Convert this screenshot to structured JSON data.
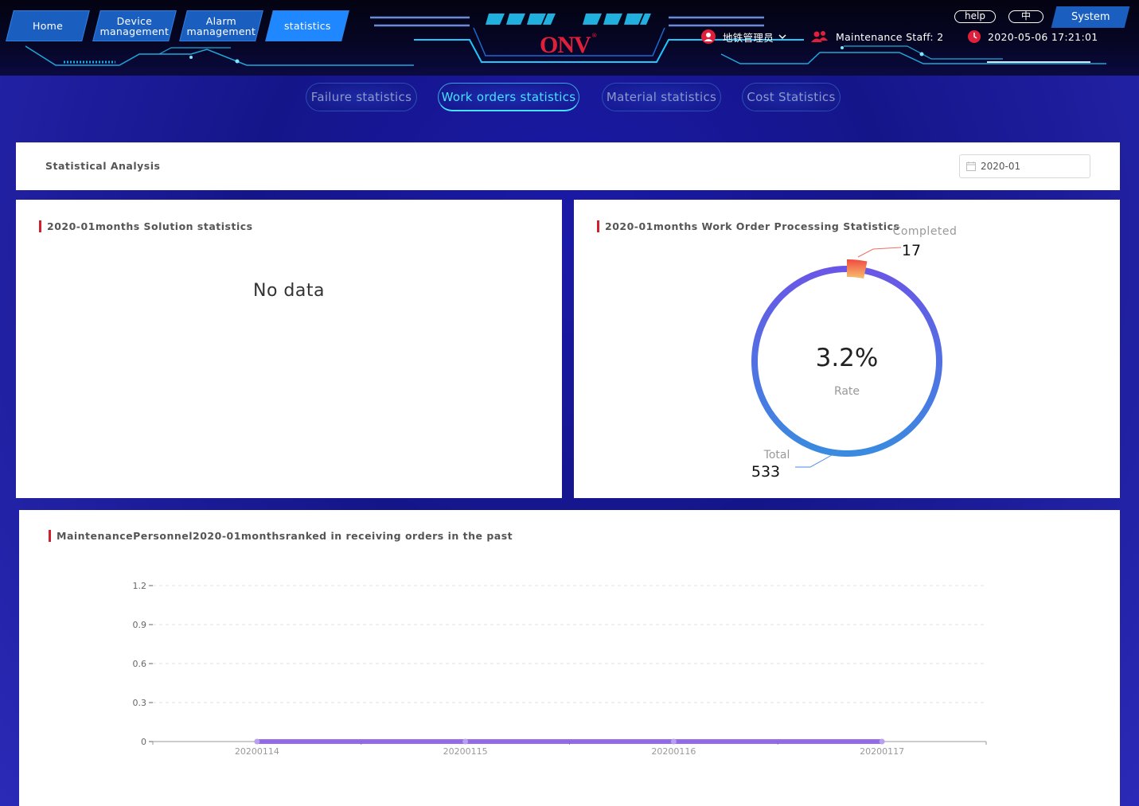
{
  "nav": {
    "tabs": [
      {
        "label": "Home"
      },
      {
        "label": "Device management"
      },
      {
        "label": "Alarm management"
      },
      {
        "label": "statistics",
        "active": true
      }
    ],
    "help_label": "help",
    "lang_label": "中",
    "system_label": "System"
  },
  "brand": {
    "logo_text": "ONV",
    "logo_mark": "®"
  },
  "status": {
    "user": "地铁管理员",
    "staff": "Maintenance Staff: 2",
    "datetime": "2020-05-06 17:21:01"
  },
  "subtabs": [
    {
      "label": "Failure statistics"
    },
    {
      "label": "Work orders statistics",
      "active": true
    },
    {
      "label": "Material statistics"
    },
    {
      "label": "Cost Statistics"
    }
  ],
  "analysis": {
    "title": "Statistical Analysis",
    "date_value": "2020-01"
  },
  "solution_panel": {
    "title": "2020-01months Solution statistics",
    "empty_text": "No data"
  },
  "workorder_panel": {
    "title": "2020-01months Work Order Processing Statistics",
    "rate_value": "3.2%",
    "rate_label": "Rate",
    "completed_label": "Completed",
    "completed_value": "17",
    "total_label": "Total",
    "total_value": "533"
  },
  "ranking_panel": {
    "title": "MaintenancePersonnel2020-01monthsranked in receiving orders in the past"
  },
  "chart_data": [
    {
      "type": "pie",
      "title": "2020-01months Work Order Processing Statistics",
      "slices": [
        {
          "label": "Completed",
          "value": 17
        },
        {
          "label": "Total",
          "value": 533
        }
      ],
      "center_value": "3.2%",
      "center_label": "Rate",
      "colors": {
        "completed": "#f06a4a",
        "total": "#5a5ce0"
      }
    },
    {
      "type": "line",
      "title": "MaintenancePersonnel2020-01monthsranked in receiving orders in the past",
      "categories": [
        "20200114",
        "20200115",
        "20200116",
        "20200117"
      ],
      "series": [
        {
          "values": [
            0,
            0,
            0,
            0
          ]
        }
      ],
      "yticks": [
        "0",
        "0.3",
        "0.6",
        "0.9",
        "1.2"
      ],
      "ylim": [
        0,
        1.2
      ],
      "grid": true,
      "colors": {
        "line": "#8a5ce8"
      }
    }
  ]
}
